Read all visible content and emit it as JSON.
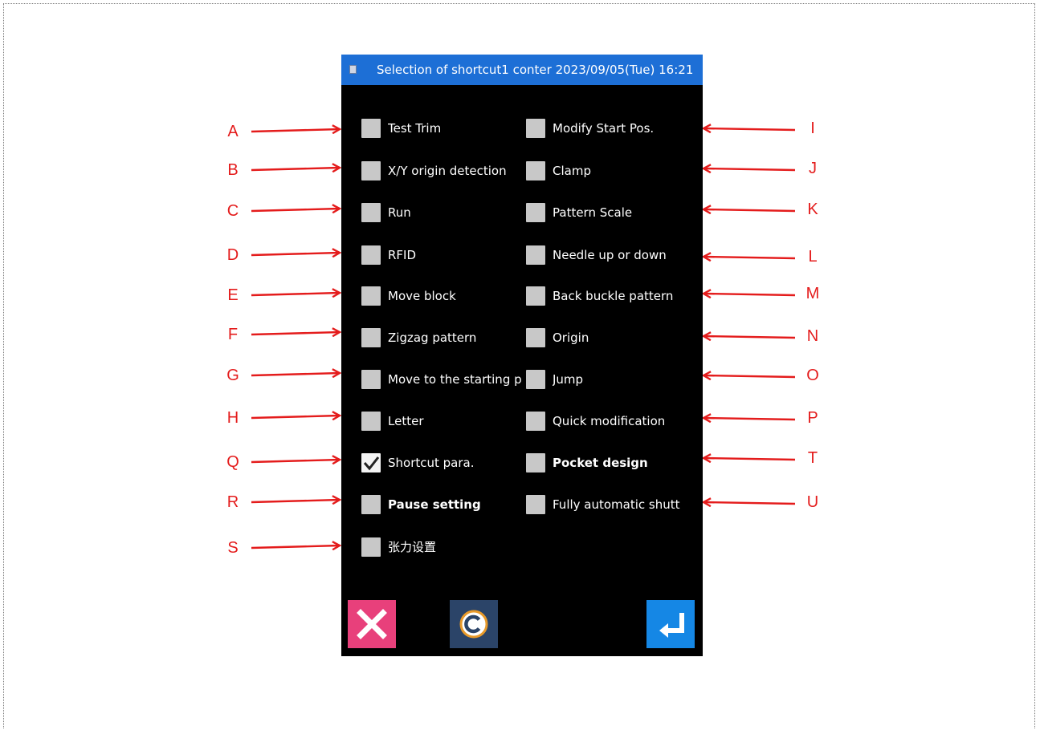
{
  "window": {
    "title": "Selection of shortcut1 conter 2023/09/05(Tue) 16:21",
    "title_icon": "monitor-icon",
    "accent_color": "#1d6fd6"
  },
  "options": {
    "left": [
      {
        "label": "Test Trim",
        "checked": false
      },
      {
        "label": "X/Y origin detection",
        "checked": false
      },
      {
        "label": "Run",
        "checked": false
      },
      {
        "label": "RFID",
        "checked": false
      },
      {
        "label": "Move block",
        "checked": false
      },
      {
        "label": "Zigzag pattern",
        "checked": false
      },
      {
        "label": "Move to the starting p",
        "checked": false
      },
      {
        "label": "Letter",
        "checked": false
      },
      {
        "label": "Shortcut para.",
        "checked": true
      },
      {
        "label": "Pause setting",
        "checked": false
      },
      {
        "label": "张力设置",
        "checked": false
      }
    ],
    "right": [
      {
        "label": "Modify Start Pos.",
        "checked": false
      },
      {
        "label": "Clamp",
        "checked": false
      },
      {
        "label": "Pattern Scale",
        "checked": false
      },
      {
        "label": "Needle up or down",
        "checked": false
      },
      {
        "label": "Back buckle pattern",
        "checked": false
      },
      {
        "label": "Origin",
        "checked": false
      },
      {
        "label": "Jump",
        "checked": false
      },
      {
        "label": "Quick modification",
        "checked": false
      },
      {
        "label": "Pocket design",
        "checked": false
      },
      {
        "label": "Fully automatic shutt",
        "checked": false
      }
    ]
  },
  "buttons": {
    "cancel": {
      "icon": "close-icon",
      "color": "#e8407b"
    },
    "clear": {
      "icon": "copyright-c-icon",
      "color": "#2b4468"
    },
    "enter": {
      "icon": "enter-return-icon",
      "color": "#1587e5"
    }
  },
  "annotations": {
    "color": "#e41c1c",
    "left_letters": [
      "A",
      "B",
      "C",
      "D",
      "E",
      "F",
      "G",
      "H",
      "Q",
      "R",
      "S"
    ],
    "right_letters": [
      "I",
      "J",
      "K",
      "L",
      "M",
      "N",
      "O",
      "P",
      "T",
      "U"
    ]
  }
}
